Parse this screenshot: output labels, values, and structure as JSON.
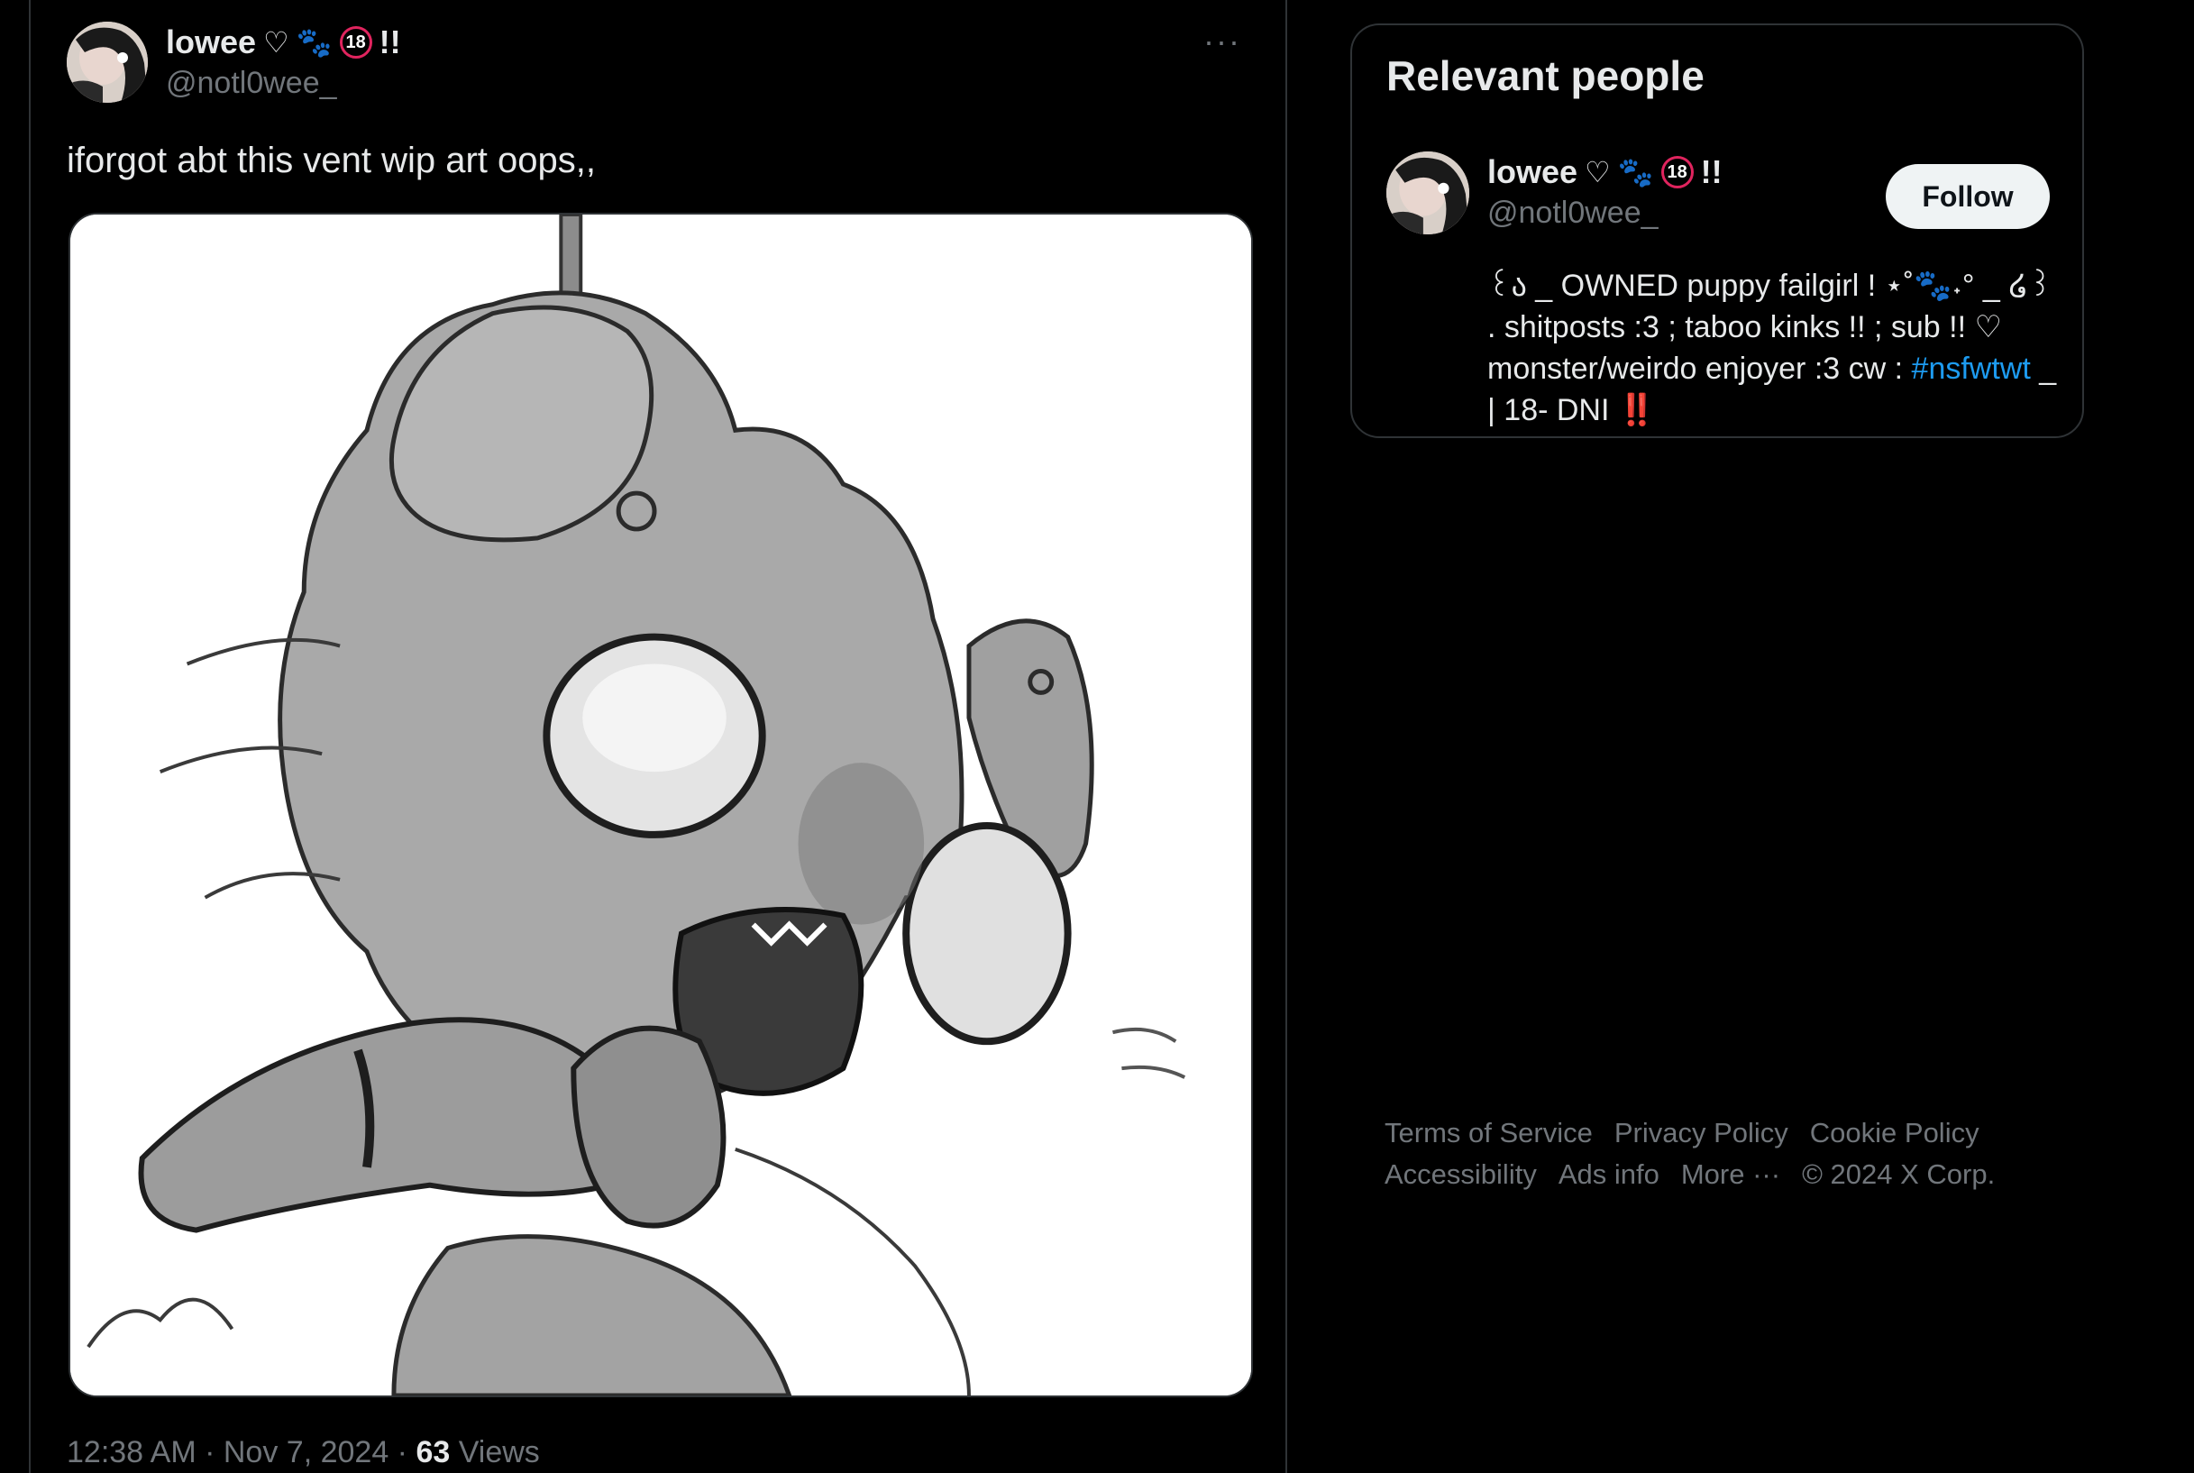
{
  "tweet": {
    "author": {
      "name": "lowee",
      "heart": "♡",
      "paw": "🐾",
      "age": "18",
      "bangs": "!!",
      "handle": "@notl0wee_"
    },
    "more": "···",
    "text": "iforgot abt this vent wip art oops,,",
    "time": "12:38 AM",
    "sep1": " · ",
    "date": "Nov 7, 2024",
    "sep2": " · ",
    "views_count": "63",
    "views_label": " Views"
  },
  "sidebar": {
    "title": "Relevant people",
    "person": {
      "name": "lowee",
      "heart": "♡",
      "paw": "🐾",
      "age": "18",
      "bangs": "!!",
      "handle": "@notl0wee_",
      "follow_label": "Follow",
      "bio_text": "꒰ა _ OWNED puppy failgirl ! ⋆˚🐾˖° _ ໒꒱ . shitposts :3 ; taboo kinks !! ; sub !! ♡ monster/weirdo enjoyer :3 cw : ",
      "bio_hashtag": "#nsfwtwt",
      "bio_tail": " _ | 18- DNI ",
      "bio_alert": "‼️"
    }
  },
  "footer": {
    "links": [
      "Terms of Service",
      "Privacy Policy",
      "Cookie Policy",
      "Accessibility",
      "Ads info",
      "More ···"
    ],
    "copyright": "© 2024 X Corp."
  },
  "colors": {
    "background": "#000000",
    "text": "#e7e9ea",
    "muted": "#71767b",
    "link": "#1d9bf0",
    "border": "#2f3336",
    "alert": "#e0245e"
  }
}
